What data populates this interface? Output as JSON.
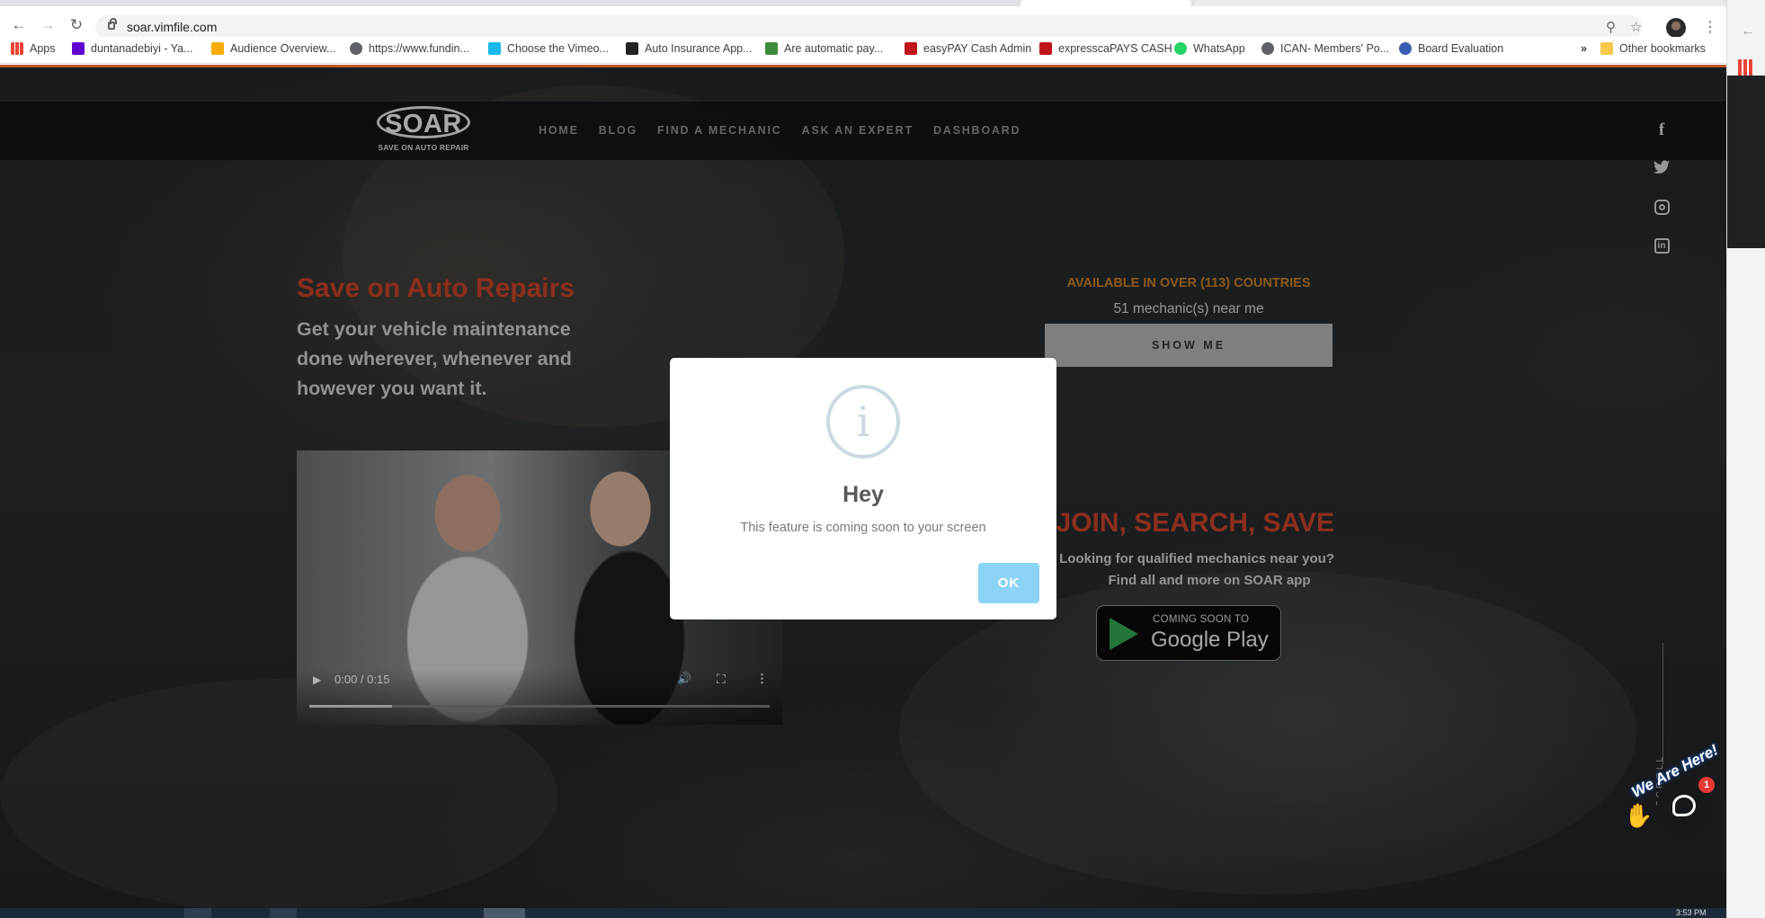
{
  "browser": {
    "url": "soar.vimfile.com",
    "bookmarks": [
      {
        "label": "Apps",
        "color": "#4285f4"
      },
      {
        "label": "duntanadebiyi - Ya...",
        "color": "#5f01d1"
      },
      {
        "label": "Audience Overview...",
        "color": "#f9ab00"
      },
      {
        "label": "https://www.fundin...",
        "color": "#5f6368"
      },
      {
        "label": "Choose the Vimeo...",
        "color": "#1ab7ea"
      },
      {
        "label": "Auto Insurance App...",
        "color": "#222222"
      },
      {
        "label": "Are automatic pay...",
        "color": "#3c8b3c"
      },
      {
        "label": "easyPAY Cash Admin",
        "color": "#c0151b"
      },
      {
        "label": "expresscaPAYS CASH",
        "color": "#c0151b"
      },
      {
        "label": "WhatsApp",
        "color": "#25d366"
      },
      {
        "label": "ICAN- Members' Po...",
        "color": "#5f6368"
      },
      {
        "label": "Board Evaluation",
        "color": "#3b5db5"
      }
    ],
    "bookmark_overflow": "»",
    "other_bookmarks": "Other bookmarks"
  },
  "site": {
    "logo_word": "SOAR",
    "logo_tagline": "SAVE ON AUTO REPAIR",
    "nav": [
      "HOME",
      "BLOG",
      "FIND A MECHANIC",
      "ASK AN EXPERT",
      "DASHBOARD"
    ],
    "social": [
      "facebook-icon",
      "twitter-icon",
      "instagram-icon",
      "linkedin-icon"
    ],
    "hero_title": "Save on Auto Repairs",
    "hero_subtitle": "Get your vehicle maintenance done wherever, whenever and however you want it.",
    "video": {
      "time": "0:00 / 0:15",
      "progress": 0.18
    },
    "availability": "AVAILABLE IN OVER (113) COUNTRIES",
    "mechanics_near": "51 mechanic(s) near me",
    "show_me": "SHOW ME",
    "join_title": "JOIN, SEARCH, SAVE",
    "looking_line": "Looking for qualified mechanics near you?",
    "find_line": "Find all and more on SOAR app",
    "google_play_small": "COMING SOON TO",
    "google_play_big": "Google Play",
    "scroll_label": "SCROLL",
    "chat_badge": "1",
    "chat_banner": "We Are Here!"
  },
  "dialog": {
    "icon": "i",
    "title": "Hey",
    "text": "This feature is coming soon to your screen",
    "ok": "OK"
  },
  "taskbar": {
    "clock": "3:53 PM"
  }
}
